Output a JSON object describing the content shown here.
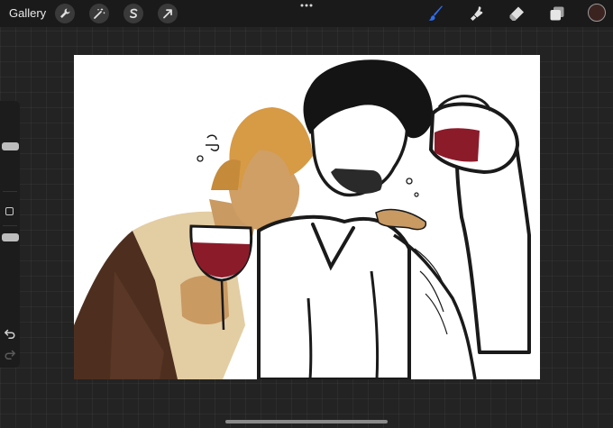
{
  "toolbar": {
    "gallery_label": "Gallery",
    "left_icons": [
      "wrench-icon",
      "magic-wand-icon",
      "selection-icon",
      "transform-arrow-icon"
    ],
    "right_icons": [
      "brush-icon",
      "smudge-icon",
      "eraser-icon",
      "layers-icon"
    ],
    "active_tool": "brush",
    "active_color": "#3b2320",
    "accent_color": "#2f6df0"
  },
  "sidebar": {
    "controls": [
      "brush-size-slider",
      "modify-button",
      "opacity-slider",
      "undo-button",
      "redo-button"
    ]
  },
  "canvas": {
    "background": "#ffffff",
    "image_content": "artwork"
  }
}
